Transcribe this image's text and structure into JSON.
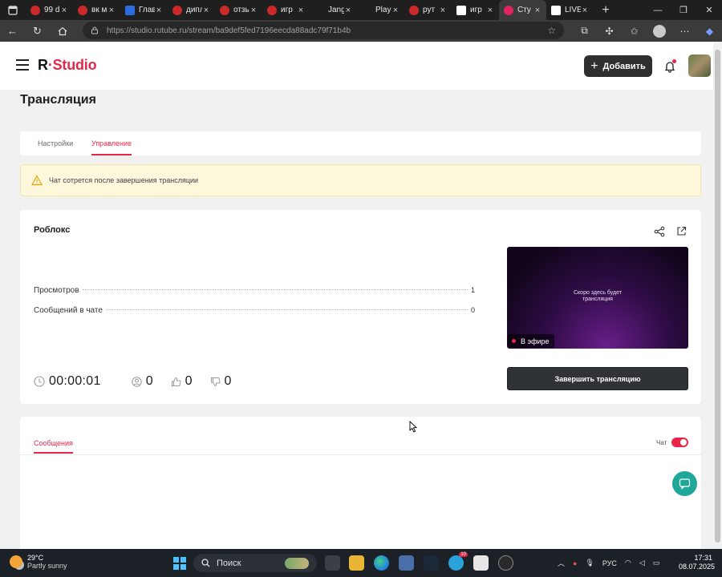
{
  "browser": {
    "tabs": [
      {
        "title": "99 d",
        "icon": "rutube-favicon"
      },
      {
        "title": "вк м",
        "icon": "rutube-favicon"
      },
      {
        "title": "Глав",
        "icon": "site-favicon"
      },
      {
        "title": "дипл",
        "icon": "rutube-favicon"
      },
      {
        "title": "отзь",
        "icon": "rutube-favicon"
      },
      {
        "title": "игр",
        "icon": "rutube-favicon"
      },
      {
        "title": "Jang",
        "icon": "none"
      },
      {
        "title": "Play",
        "icon": "none"
      },
      {
        "title": "рут",
        "icon": "rutube-favicon"
      },
      {
        "title": "игр",
        "icon": "rutube-logo-favicon"
      },
      {
        "title": "Сту",
        "icon": "studio-favicon"
      },
      {
        "title": "LIVE",
        "icon": "rutube-logo-favicon"
      }
    ],
    "active_tab": 10,
    "url": "https://studio.rutube.ru/stream/ba9def5fed7196eecda88adc79f71b4b"
  },
  "header": {
    "logo_r": "R",
    "logo_studio": "Studio",
    "add_button": "Добавить"
  },
  "page": {
    "title": "Трансляция",
    "tabs": [
      {
        "label": "Настройки",
        "active": false
      },
      {
        "label": "Управление",
        "active": true
      }
    ],
    "warning": "Чат сотрется после завершения трансляции"
  },
  "stream": {
    "name": "Роблокс",
    "stats": [
      {
        "label": "Просмотров",
        "value": "1"
      },
      {
        "label": "Сообщений в чате",
        "value": "0"
      }
    ],
    "duration": "00:00:01",
    "viewers": "0",
    "likes": "0",
    "dislikes": "0",
    "preview_text_1": "Скоро здесь будет",
    "preview_text_2": "трансляция",
    "live_label": "В эфире",
    "end_button": "Завершить трансляцию"
  },
  "chat": {
    "tab_label": "Сообщения",
    "toggle_label": "Чат",
    "toggle_on": true
  },
  "taskbar": {
    "temperature": "29°C",
    "weather": "Partly sunny",
    "search": "Поиск",
    "language": "РУС",
    "time": "17:31",
    "date": "08.07.2025",
    "notification_count": "10"
  },
  "colors": {
    "accent": "#e8264a",
    "dark_button": "#2f2f2f",
    "warning_bg": "#fdf7dc",
    "support_button": "#1fa79a"
  }
}
